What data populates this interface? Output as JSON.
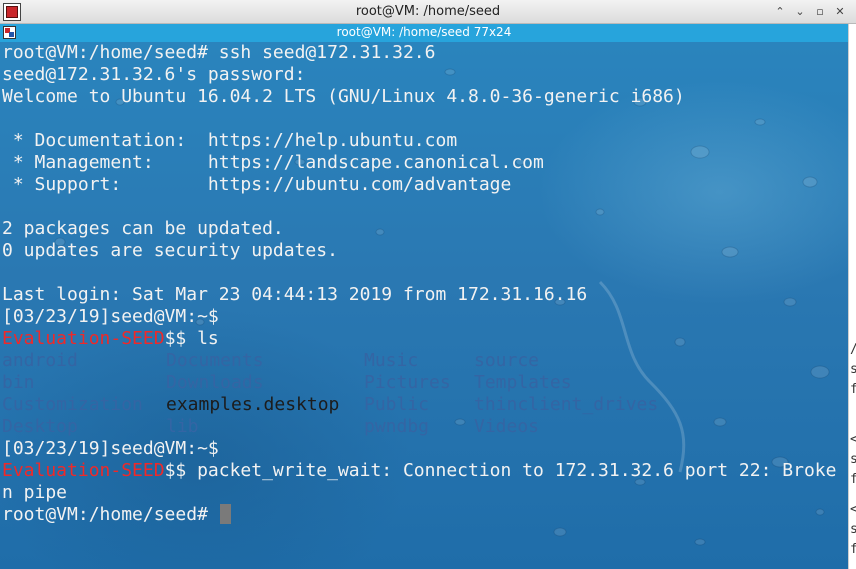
{
  "window": {
    "title": "root@VM: /home/seed",
    "buttons": [
      "⌃",
      "⌄",
      "▫",
      "✕"
    ]
  },
  "terminal": {
    "header_title": "root@VM: /home/seed 77x24",
    "lines": [
      {
        "type": "text",
        "text": "root@VM:/home/seed# ssh seed@172.31.32.6"
      },
      {
        "type": "text",
        "text": "seed@172.31.32.6's password:"
      },
      {
        "type": "text",
        "text": "Welcome to Ubuntu 16.04.2 LTS (GNU/Linux 4.8.0-36-generic i686)"
      },
      {
        "type": "text",
        "text": ""
      },
      {
        "type": "text",
        "text": " * Documentation:  https://help.ubuntu.com"
      },
      {
        "type": "text",
        "text": " * Management:     https://landscape.canonical.com"
      },
      {
        "type": "text",
        "text": " * Support:        https://ubuntu.com/advantage"
      },
      {
        "type": "text",
        "text": ""
      },
      {
        "type": "text",
        "text": "2 packages can be updated."
      },
      {
        "type": "text",
        "text": "0 updates are security updates."
      },
      {
        "type": "text",
        "text": ""
      },
      {
        "type": "text",
        "text": "Last login: Sat Mar 23 04:44:13 2019 from 172.31.16.16"
      },
      {
        "type": "text",
        "text": "[03/23/19]seed@VM:~$"
      },
      {
        "type": "prompt",
        "label": "Evaluation-SEED",
        "suffix": "$$ ls"
      }
    ],
    "ls_rows": [
      [
        {
          "name": "android",
          "kind": "dir"
        },
        {
          "name": "Documents",
          "kind": "dir"
        },
        {
          "name": "Music",
          "kind": "dir"
        },
        {
          "name": "source",
          "kind": "dir"
        }
      ],
      [
        {
          "name": "bin",
          "kind": "dir"
        },
        {
          "name": "Downloads",
          "kind": "dir"
        },
        {
          "name": "Pictures",
          "kind": "dir"
        },
        {
          "name": "Templates",
          "kind": "dir"
        }
      ],
      [
        {
          "name": "Customization",
          "kind": "dir"
        },
        {
          "name": "examples.desktop",
          "kind": "file"
        },
        {
          "name": "Public",
          "kind": "dir"
        },
        {
          "name": "thinclient_drives",
          "kind": "dir"
        }
      ],
      [
        {
          "name": "Desktop",
          "kind": "dir"
        },
        {
          "name": "lib",
          "kind": "dir"
        },
        {
          "name": "pwndbg",
          "kind": "dir"
        },
        {
          "name": "Videos",
          "kind": "dir"
        }
      ]
    ],
    "after_lines": [
      {
        "type": "text",
        "text": "[03/23/19]seed@VM:~$"
      },
      {
        "type": "prompt",
        "label": "Evaluation-SEED",
        "suffix": "$$ packet_write_wait: Connection to 172.31.32.6 port 22: Broke"
      },
      {
        "type": "text",
        "text": "n pipe"
      },
      {
        "type": "cursor",
        "text": "root@VM:/home/seed# "
      }
    ],
    "colors": {
      "prompt_label": "#ef2929",
      "dir": "#3465a4",
      "file": "#1c1c1c",
      "text": "#f2f2f2"
    }
  },
  "right_edge_glyphs": [
    "/",
    "s",
    "f",
    "<",
    "s",
    "f",
    "<",
    "s",
    "f"
  ]
}
